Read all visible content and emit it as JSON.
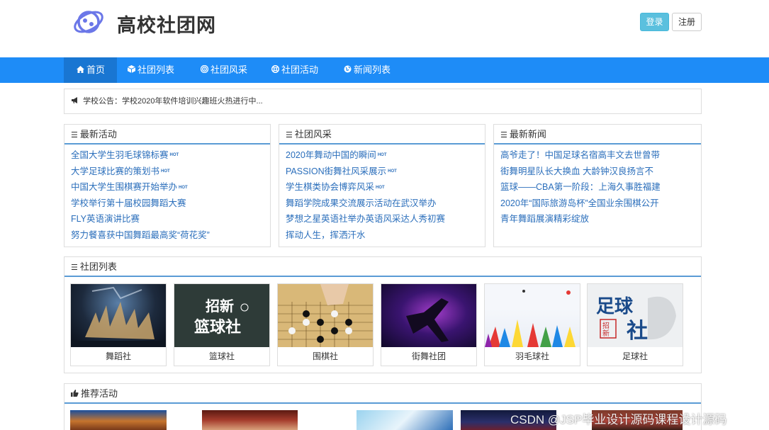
{
  "header": {
    "site_title": "高校社团网",
    "login_label": "登录",
    "register_label": "注册"
  },
  "nav": [
    {
      "label": "首页",
      "icon": "home-icon"
    },
    {
      "label": "社团列表",
      "icon": "cube-icon"
    },
    {
      "label": "社团风采",
      "icon": "target-icon"
    },
    {
      "label": "社团活动",
      "icon": "lifebuoy-icon"
    },
    {
      "label": "新闻列表",
      "icon": "globe-icon"
    }
  ],
  "notice": {
    "icon": "bullhorn-icon",
    "text": "学校公告：学校2020年软件培训兴趣班火热进行中..."
  },
  "latest_activities": {
    "title": "最新活动",
    "items": [
      {
        "text": "全国大学生羽毛球锦标赛",
        "hot": "HOT"
      },
      {
        "text": "大学足球比赛的策划书",
        "hot": "HOT"
      },
      {
        "text": "中国大学生围棋赛开始举办",
        "hot": "HOT"
      },
      {
        "text": "学校举行第十届校园舞蹈大赛",
        "hot": ""
      },
      {
        "text": "FLY英语演讲比赛",
        "hot": ""
      },
      {
        "text": "努力餐喜获中国舞蹈最高奖“荷花奖”",
        "hot": ""
      }
    ]
  },
  "club_style": {
    "title": "社团风采",
    "items": [
      {
        "text": "2020年舞动中国的瞬间",
        "hot": "HOT"
      },
      {
        "text": "PASSION街舞社风采展示",
        "hot": "HOT"
      },
      {
        "text": "学生棋类协会博弈风采",
        "hot": "HOT"
      },
      {
        "text": "舞蹈学院成果交流展示活动在武汉举办",
        "hot": ""
      },
      {
        "text": "梦想之星英语社举办英语风采达人秀初赛",
        "hot": ""
      },
      {
        "text": "挥动人生，挥洒汗水",
        "hot": ""
      }
    ]
  },
  "latest_news": {
    "title": "最新新闻",
    "items": [
      {
        "text": "高爷走了！中国足球名宿高丰文去世曾带"
      },
      {
        "text": "街舞明星队长大换血 大龄钟汉良扬言不"
      },
      {
        "text": "篮球——CBA第一阶段：上海久事胜福建"
      },
      {
        "text": "2020年“国际旅游岛杯”全国业余围棋公开"
      },
      {
        "text": "青年舞蹈展演精彩绽放"
      }
    ]
  },
  "club_list": {
    "title": "社团列表",
    "clubs": [
      {
        "name": "舞蹈社"
      },
      {
        "name": "篮球社",
        "image_text": "招新\n篮球社"
      },
      {
        "name": "围棋社"
      },
      {
        "name": "街舞社团"
      },
      {
        "name": "羽毛球社"
      },
      {
        "name": "足球社",
        "image_text": "足球社\n招新"
      }
    ]
  },
  "recommended": {
    "title": "推荐活动",
    "icon": "thumbs-up-icon"
  },
  "watermark": "CSDN @JSP毕业设计源码课程设计源码",
  "colors": {
    "nav_bg": "#1e8cf7",
    "nav_active": "#1976d2",
    "link": "#2a6ebb",
    "login_btn": "#5bc0de",
    "panel_border": "#5a9bd5"
  }
}
